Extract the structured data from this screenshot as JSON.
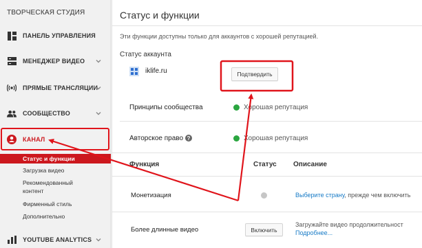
{
  "sidebar": {
    "studio_title": "ТВОРЧЕСКАЯ СТУДИЯ",
    "items": [
      {
        "label": "ПАНЕЛЬ УПРАВЛЕНИЯ",
        "icon": "dashboard-icon"
      },
      {
        "label": "МЕНЕДЖЕР ВИДЕО",
        "icon": "video-manager-icon"
      },
      {
        "label": "ПРЯМЫЕ ТРАНСЛЯЦИИ",
        "icon": "live-broadcast-icon"
      },
      {
        "label": "СООБЩЕСТВО",
        "icon": "community-icon"
      },
      {
        "label": "КАНАЛ",
        "icon": "channel-icon"
      },
      {
        "label": "YOUTUBE ANALYTICS",
        "icon": "analytics-icon"
      }
    ],
    "channel_subitems": [
      "Статус и функции",
      "Загрузка видео",
      "Рекомендованный",
      "контент",
      "Фирменный стиль",
      "Дополнительно"
    ]
  },
  "main": {
    "title": "Статус и функции",
    "description": "Эти функции доступны только для аккаунтов с хорошей репутацией.",
    "account_status_label": "Статус аккаунта",
    "account_name": "iklife.ru",
    "confirm_button": "Подтвердить",
    "community_guidelines_label": "Принципы сообщества",
    "community_guidelines_status": "Хорошая репутация",
    "copyright_label": "Авторское право",
    "copyright_status": "Хорошая репутация",
    "table": {
      "headers": [
        "Функция",
        "Статус",
        "Описание"
      ],
      "rows": [
        {
          "feature": "Монетизация",
          "desc_link": "Выберите страну",
          "desc_rest": ", прежде чем включить"
        },
        {
          "feature": "Более длинные видео",
          "button": "Включить",
          "desc_text": "Загружайте видео продолжительност",
          "desc_link": "Подробнее..."
        }
      ]
    }
  },
  "colors": {
    "accent_red": "#cc181e",
    "status_green": "#2ba640",
    "status_grey": "#c6c6c6",
    "link_blue": "#167ac6",
    "annotation_red": "#e0141b"
  }
}
